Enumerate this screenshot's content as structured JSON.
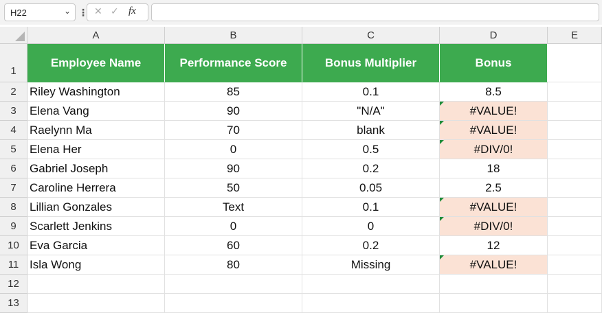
{
  "name_box": {
    "value": "H22",
    "caret": "⌄"
  },
  "formula_bar": {
    "separator": "⋮",
    "cancel": "✕",
    "enter": "✓",
    "fx": "fx",
    "value": ""
  },
  "columns": [
    "A",
    "B",
    "C",
    "D",
    "E"
  ],
  "rows": [
    "1",
    "2",
    "3",
    "4",
    "5",
    "6",
    "7",
    "8",
    "9",
    "10",
    "11",
    "12",
    "13"
  ],
  "header": {
    "name": "Employee Name",
    "score": "Performance Score",
    "multiplier": "Bonus Multiplier",
    "bonus": "Bonus"
  },
  "data": [
    {
      "name": "Riley Washington",
      "score": "85",
      "multiplier": "0.1",
      "bonus": "8.5",
      "error": false
    },
    {
      "name": "Elena Vang",
      "score": "90",
      "multiplier": "\"N/A\"",
      "bonus": "#VALUE!",
      "error": true
    },
    {
      "name": "Raelynn Ma",
      "score": "70",
      "multiplier": "blank",
      "bonus": "#VALUE!",
      "error": true
    },
    {
      "name": "Elena Her",
      "score": "0",
      "multiplier": "0.5",
      "bonus": "#DIV/0!",
      "error": true
    },
    {
      "name": "Gabriel Joseph",
      "score": "90",
      "multiplier": "0.2",
      "bonus": "18",
      "error": false
    },
    {
      "name": "Caroline Herrera",
      "score": "50",
      "multiplier": "0.05",
      "bonus": "2.5",
      "error": false
    },
    {
      "name": "Lillian Gonzales",
      "score": "Text",
      "multiplier": "0.1",
      "bonus": "#VALUE!",
      "error": true
    },
    {
      "name": "Scarlett Jenkins",
      "score": "0",
      "multiplier": "0",
      "bonus": "#DIV/0!",
      "error": true
    },
    {
      "name": "Eva Garcia",
      "score": "60",
      "multiplier": "0.2",
      "bonus": "12",
      "error": false
    },
    {
      "name": "Isla Wong",
      "score": "80",
      "multiplier": "Missing",
      "bonus": "#VALUE!",
      "error": true
    }
  ],
  "colors": {
    "header_fill": "#3daa4f",
    "error_fill": "#fbe2d5",
    "error_flag": "#1e8c3a"
  }
}
